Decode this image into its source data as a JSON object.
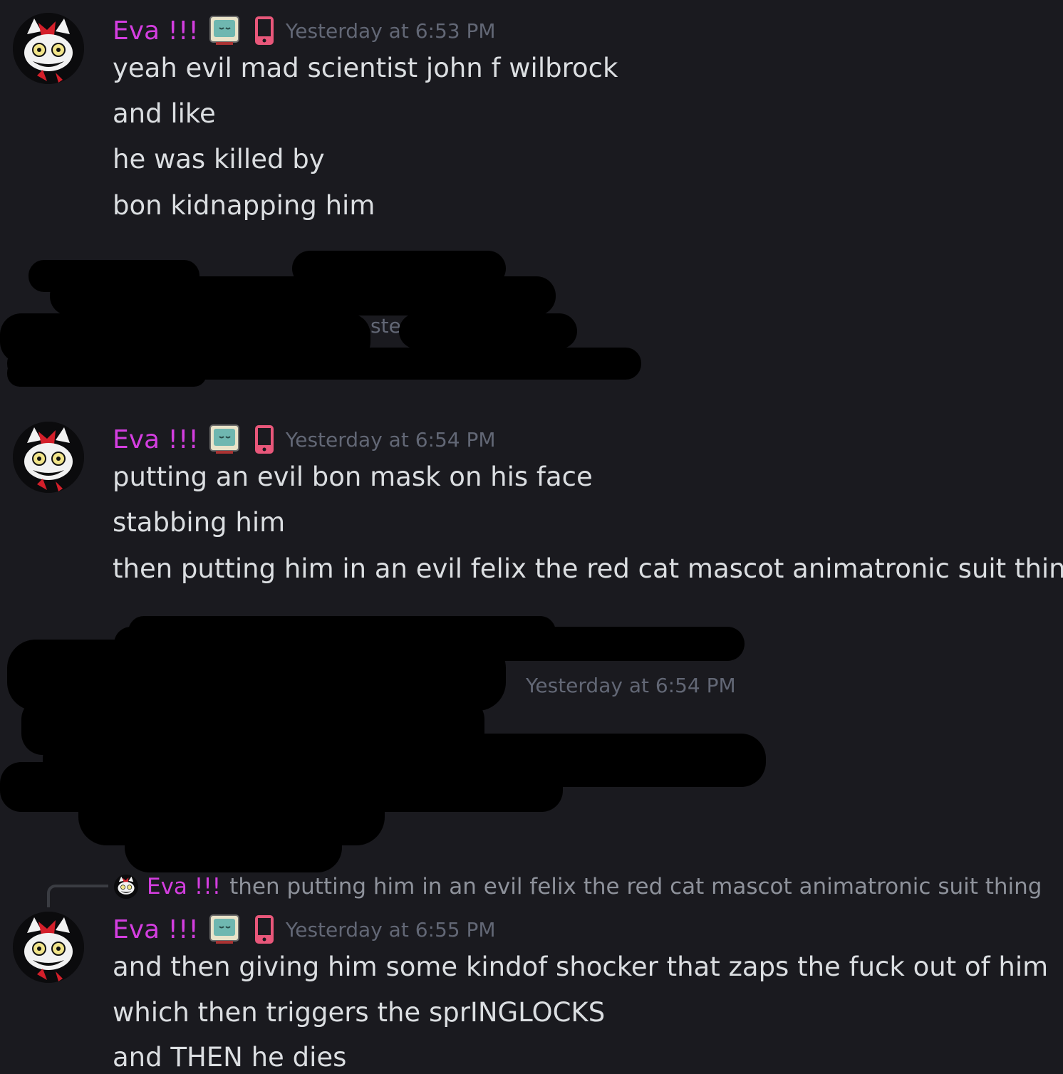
{
  "colors": {
    "background": "#1a1a1f",
    "username": "#d43ee0",
    "timestamp": "#626775",
    "text": "#dbdee1",
    "phone_badge": "#e8577a",
    "tv_badge": "#6fb7b0"
  },
  "messages": [
    {
      "author": "Eva !!!",
      "timestamp": "Yesterday at 6:53 PM",
      "lines": [
        "yeah evil mad scientist john f wilbrock",
        "and like",
        "he was killed by",
        "bon kidnapping him"
      ]
    },
    {
      "author": "Eva !!!",
      "timestamp": "Yesterday at 6:54 PM",
      "lines": [
        "putting an evil bon mask on his face",
        "stabbing him",
        "then putting him in an evil felix the red cat mascot animatronic suit thing"
      ]
    },
    {
      "author": "Eva !!!",
      "timestamp": "Yesterday at 6:55 PM",
      "reply": {
        "author": "Eva !!!",
        "text": "then putting him in an evil felix the red cat mascot animatronic suit thing"
      },
      "lines": [
        "and then giving him some kindof shocker that zaps the fuck out of him",
        "which then triggers the sprINGLOCKS",
        "and THEN he dies"
      ]
    }
  ],
  "redacted_blocks": [
    {
      "visible_fragment": "ste"
    },
    {
      "visible_timestamp": "Yesterday at 6:54 PM"
    }
  ],
  "icons": {
    "avatar": "cat-avatar-icon",
    "tv": "tv-badge-icon",
    "phone": "mobile-phone-icon"
  }
}
